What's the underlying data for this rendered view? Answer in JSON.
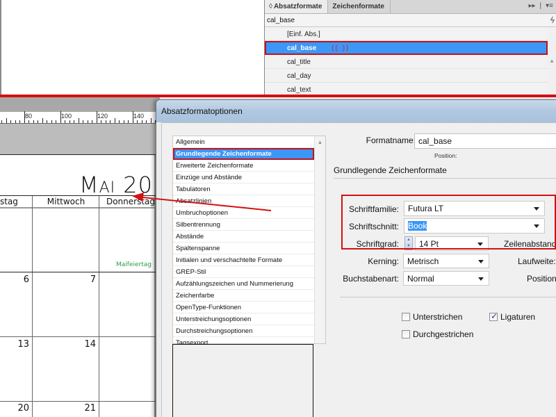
{
  "styles_panel": {
    "tabs": [
      {
        "label": "Absatzformate",
        "active": true
      },
      {
        "label": "Zeichenformate",
        "active": false
      }
    ],
    "sort_glyph": "◊",
    "menu_icons": [
      "▸▸",
      "|",
      "▾≡"
    ],
    "current_style": "cal_base",
    "quick_apply_glyph": "ϟ",
    "items": [
      {
        "label": "[Einf. Abs.]",
        "selected": false
      },
      {
        "label": "cal_base",
        "selected": true
      },
      {
        "label": "cal_title",
        "selected": false
      },
      {
        "label": "cal_day",
        "selected": false
      },
      {
        "label": "cal_text",
        "selected": false
      }
    ],
    "cursor_marker": "(( ))"
  },
  "document": {
    "ruler_labels": [
      "80",
      "100",
      "120",
      "140"
    ],
    "calendar": {
      "month_title_cap": "M",
      "month_title_rest": "AI",
      "year_partial": "20",
      "column_headers": [
        "stag",
        "Mittwoch",
        "Donnerstag"
      ],
      "day_numbers": [
        {
          "row": 1,
          "col": 0,
          "value": "6"
        },
        {
          "row": 1,
          "col": 1,
          "value": "7"
        },
        {
          "row": 2,
          "col": 0,
          "value": "13"
        },
        {
          "row": 2,
          "col": 1,
          "value": "14"
        },
        {
          "row": 3,
          "col": 0,
          "value": "20"
        },
        {
          "row": 3,
          "col": 1,
          "value": "21"
        }
      ],
      "holiday_label": "Maifeiertag",
      "holiday_color": "#2e9a4a"
    }
  },
  "dialog": {
    "title": "Absatzformatoptionen",
    "categories": [
      {
        "label": "Allgemein",
        "selected": false
      },
      {
        "label": "Grundlegende Zeichenformate",
        "selected": true
      },
      {
        "label": "Erweiterte Zeichenformate",
        "selected": false
      },
      {
        "label": "Einzüge und Abstände",
        "selected": false
      },
      {
        "label": "Tabulatoren",
        "selected": false
      },
      {
        "label": "Absatzlinien",
        "selected": false
      },
      {
        "label": "Umbruchoptionen",
        "selected": false
      },
      {
        "label": "Silbentrennung",
        "selected": false
      },
      {
        "label": "Abstände",
        "selected": false
      },
      {
        "label": "Spaltenspanne",
        "selected": false
      },
      {
        "label": "Initialen und verschachtelte Formate",
        "selected": false
      },
      {
        "label": "GREP-Stil",
        "selected": false
      },
      {
        "label": "Aufzählungszeichen und Nummerierung",
        "selected": false
      },
      {
        "label": "Zeichenfarbe",
        "selected": false
      },
      {
        "label": "OpenType-Funktionen",
        "selected": false
      },
      {
        "label": "Unterstreichungsoptionen",
        "selected": false
      },
      {
        "label": "Durchstreichungsoptionen",
        "selected": false
      },
      {
        "label": "Tagsexport",
        "selected": false
      }
    ],
    "format_name_label": "Formatname:",
    "format_name_value": "cal_base",
    "position_label": "Position:",
    "section_title": "Grundlegende Zeichenformate",
    "fields": {
      "font_family": {
        "label": "Schriftfamilie:",
        "value": "Futura LT"
      },
      "font_style": {
        "label": "Schriftschnitt:",
        "value": "Book"
      },
      "font_size": {
        "label": "Schriftgrad:",
        "value": "14 Pt"
      },
      "leading": {
        "label": "Zeilenabstand:"
      },
      "kerning": {
        "label": "Kerning:",
        "value": "Metrisch"
      },
      "tracking": {
        "label": "Laufweite:"
      },
      "case": {
        "label": "Buchstabenart:",
        "value": "Normal"
      },
      "position": {
        "label": "Position:"
      }
    },
    "checkboxes": [
      {
        "label": "Unterstrichen",
        "checked": false
      },
      {
        "label": "Ligaturen",
        "checked": true
      },
      {
        "label": "Durchgestrichen",
        "checked": false
      }
    ]
  },
  "colors": {
    "selection_blue": "#3c97f7",
    "annotation_red": "#d51010"
  }
}
